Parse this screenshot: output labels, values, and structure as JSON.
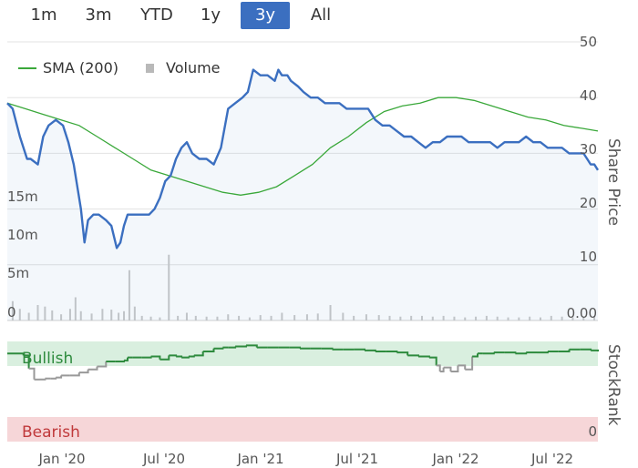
{
  "ranges": {
    "buttons": [
      {
        "label": "1m"
      },
      {
        "label": "3m"
      },
      {
        "label": "YTD"
      },
      {
        "label": "1y"
      },
      {
        "label": "3y"
      },
      {
        "label": "All"
      }
    ],
    "active": "3y"
  },
  "colors": {
    "price_line": "#3b6fc0",
    "sma_line": "#3aa83a",
    "volume_bar": "#c9c9c9",
    "bullish_band": "#d9efdf",
    "bullish_text": "#2e8b3e",
    "bearish_band": "#f6d6d8",
    "bearish_text": "#c0393b",
    "stockrank_bull": "#2e8b3e",
    "stockrank_bear": "#999999",
    "active_button": "#3b6fc0"
  },
  "chart_data": {
    "type": "line",
    "legend": {
      "placement": "top-left",
      "entries": [
        "SMA (200)",
        "Volume"
      ]
    },
    "right_axis_title": "Share Price",
    "right_ticks": [
      "50",
      "40",
      "30",
      "20",
      "10",
      "0.00"
    ],
    "left_volume_ticks": [
      "15m",
      "10m",
      "5m",
      "0"
    ],
    "x_ticks": [
      "Jan '20",
      "Jul '20",
      "Jan '21",
      "Jul '21",
      "Jan '22",
      "Jul '22"
    ],
    "price_ylim": [
      0,
      50
    ],
    "volume_ylim": [
      0,
      20
    ],
    "x_range_months": [
      -1.5,
      8.8
    ],
    "series": [
      {
        "name": "Share Price",
        "x": [
          -1.5,
          -1.2,
          -0.8,
          -0.4,
          -0.2,
          0.2,
          0.5,
          0.8,
          1.2,
          1.6,
          1.9,
          2.2,
          2.6,
          2.8,
          3.0,
          3.3,
          3.6,
          4.0,
          4.3,
          4.6,
          4.8,
          5.0,
          5.2,
          5.5,
          5.8,
          6.1,
          6.4,
          6.7,
          7.0,
          7.3,
          7.6,
          7.9,
          8.2,
          8.5,
          8.8,
          9.2,
          9.6,
          10.0,
          10.4,
          10.8,
          11.2,
          11.6,
          11.9,
          12.2,
          12.6,
          13.0,
          13.4,
          13.6,
          13.8,
          14.1,
          14.3,
          14.7,
          15.0,
          15.4,
          15.8,
          16.2,
          16.6,
          17.0,
          17.4,
          17.8,
          18.2,
          18.6,
          19.0,
          19.4,
          19.8,
          20.2,
          20.6,
          21.0,
          21.4,
          21.8,
          22.2,
          22.6,
          23.0,
          23.4,
          23.8,
          24.2,
          24.6,
          25.0,
          25.4,
          25.8,
          26.2,
          26.6,
          27.0,
          27.4,
          27.8,
          28.2,
          28.6,
          29.0,
          29.4,
          29.8,
          30.2,
          30.6,
          30.8,
          31.0,
          31.2,
          31.4
        ],
        "values": [
          39,
          38,
          33,
          29,
          29,
          28,
          33,
          35,
          36,
          35,
          32,
          28,
          20,
          14,
          18,
          19,
          19,
          18,
          17,
          13,
          14,
          17,
          19,
          19,
          19,
          19,
          19,
          20,
          22,
          25,
          26,
          29,
          31,
          32,
          30,
          29,
          29,
          28,
          31,
          38,
          39,
          40,
          41,
          45,
          44,
          44,
          43,
          45,
          44,
          44,
          43,
          42,
          41,
          40,
          40,
          39,
          39,
          39,
          38,
          38,
          38,
          38,
          36,
          35,
          35,
          34,
          33,
          33,
          32,
          31,
          32,
          32,
          33,
          33,
          33,
          32,
          32,
          32,
          32,
          31,
          32,
          32,
          32,
          33,
          32,
          32,
          31,
          31,
          31,
          30,
          30,
          30,
          29,
          28,
          28,
          27
        ]
      },
      {
        "name": "SMA (200)",
        "x": [
          -1.5,
          -0.5,
          0.5,
          1.5,
          2.5,
          3.5,
          4.5,
          5.5,
          6.5,
          7.5,
          8.5,
          9.5,
          10.5,
          11.5,
          12.5,
          13.5,
          14.5,
          15.5,
          16.5,
          17.5,
          18.5,
          19.5,
          20.5,
          21.5,
          22.5,
          23.5,
          24.5,
          25.5,
          26.5,
          27.5,
          28.5,
          29.5,
          30.5,
          31.4
        ],
        "values": [
          39,
          38,
          37,
          36,
          35,
          33,
          31,
          29,
          27,
          26,
          25,
          24,
          23,
          22.5,
          23,
          24,
          26,
          28,
          31,
          33,
          35.5,
          37.5,
          38.5,
          39,
          40,
          40,
          39.5,
          38.5,
          37.5,
          36.5,
          36,
          35,
          34.5,
          34
        ]
      }
    ],
    "volume": {
      "x": [
        -1.2,
        -0.8,
        -0.3,
        0.2,
        0.6,
        1.0,
        1.5,
        2.0,
        2.3,
        2.6,
        3.2,
        3.8,
        4.3,
        4.7,
        5.0,
        5.3,
        5.6,
        6.0,
        6.5,
        7.0,
        7.5,
        8.0,
        8.5,
        9.0,
        9.6,
        10.2,
        10.8,
        11.4,
        12.0,
        12.6,
        13.2,
        13.8,
        14.5,
        15.2,
        15.8,
        16.5,
        17.2,
        17.8,
        18.5,
        19.2,
        19.8,
        20.4,
        21.0,
        21.6,
        22.2,
        22.8,
        23.4,
        24.0,
        24.6,
        25.2,
        25.8,
        26.4,
        27.0,
        27.6,
        28.2,
        28.8,
        29.4,
        30.0,
        30.6,
        31.2
      ],
      "values": [
        2.5,
        1.5,
        1.0,
        2.0,
        1.8,
        1.3,
        0.8,
        1.5,
        3.0,
        1.2,
        0.9,
        1.5,
        1.4,
        1.0,
        1.2,
        6.5,
        1.8,
        0.6,
        0.5,
        0.4,
        8.5,
        0.6,
        1.0,
        0.6,
        0.5,
        0.5,
        0.8,
        0.6,
        0.4,
        0.7,
        0.6,
        1.0,
        0.7,
        0.8,
        0.9,
        2.0,
        1.0,
        0.6,
        0.8,
        0.7,
        0.6,
        0.5,
        0.6,
        0.6,
        0.5,
        0.6,
        0.5,
        0.4,
        0.5,
        0.6,
        0.5,
        0.4,
        0.4,
        0.5,
        0.4,
        0.6,
        0.5,
        0.4,
        0.5,
        0.6
      ]
    },
    "stockrank": {
      "labels": {
        "bullish": "Bullish",
        "bearish": "Bearish"
      },
      "axis_title": "StockRank",
      "right_ticks": [
        "",
        "0"
      ],
      "ylim": [
        0,
        100
      ],
      "x": [
        -1.5,
        -0.6,
        -0.3,
        0.0,
        0.3,
        0.6,
        0.9,
        1.2,
        1.5,
        2.0,
        2.5,
        3.0,
        3.5,
        4.0,
        4.5,
        5.0,
        5.2,
        5.5,
        6.0,
        6.5,
        7.0,
        7.5,
        7.9,
        8.2,
        8.6,
        8.9,
        9.4,
        10.0,
        10.5,
        10.8,
        11.2,
        11.8,
        12.4,
        13.0,
        13.6,
        14.2,
        14.8,
        15.4,
        16.0,
        16.6,
        17.2,
        17.8,
        18.4,
        19.0,
        19.6,
        20.2,
        20.8,
        21.4,
        22.0,
        22.4,
        22.6,
        22.8,
        23.2,
        23.6,
        24.0,
        24.4,
        24.7,
        25.0,
        25.6,
        26.2,
        26.8,
        27.4,
        28.0,
        28.6,
        29.2,
        29.8,
        30.4,
        31.0,
        31.4
      ],
      "values": [
        88,
        86,
        73,
        62,
        62,
        63,
        63,
        64,
        66,
        66,
        69,
        72,
        75,
        80,
        80,
        81,
        84,
        84,
        84,
        85,
        82,
        86,
        85,
        84,
        85,
        86,
        90,
        93,
        94,
        94,
        95,
        96,
        94,
        94,
        94,
        94,
        93,
        93,
        93,
        92,
        92,
        92,
        91,
        90,
        90,
        89,
        86,
        85,
        84,
        76,
        70,
        74,
        70,
        76,
        72,
        85,
        88,
        88,
        89,
        89,
        88,
        89,
        89,
        90,
        90,
        92,
        92,
        91,
        90
      ]
    }
  }
}
